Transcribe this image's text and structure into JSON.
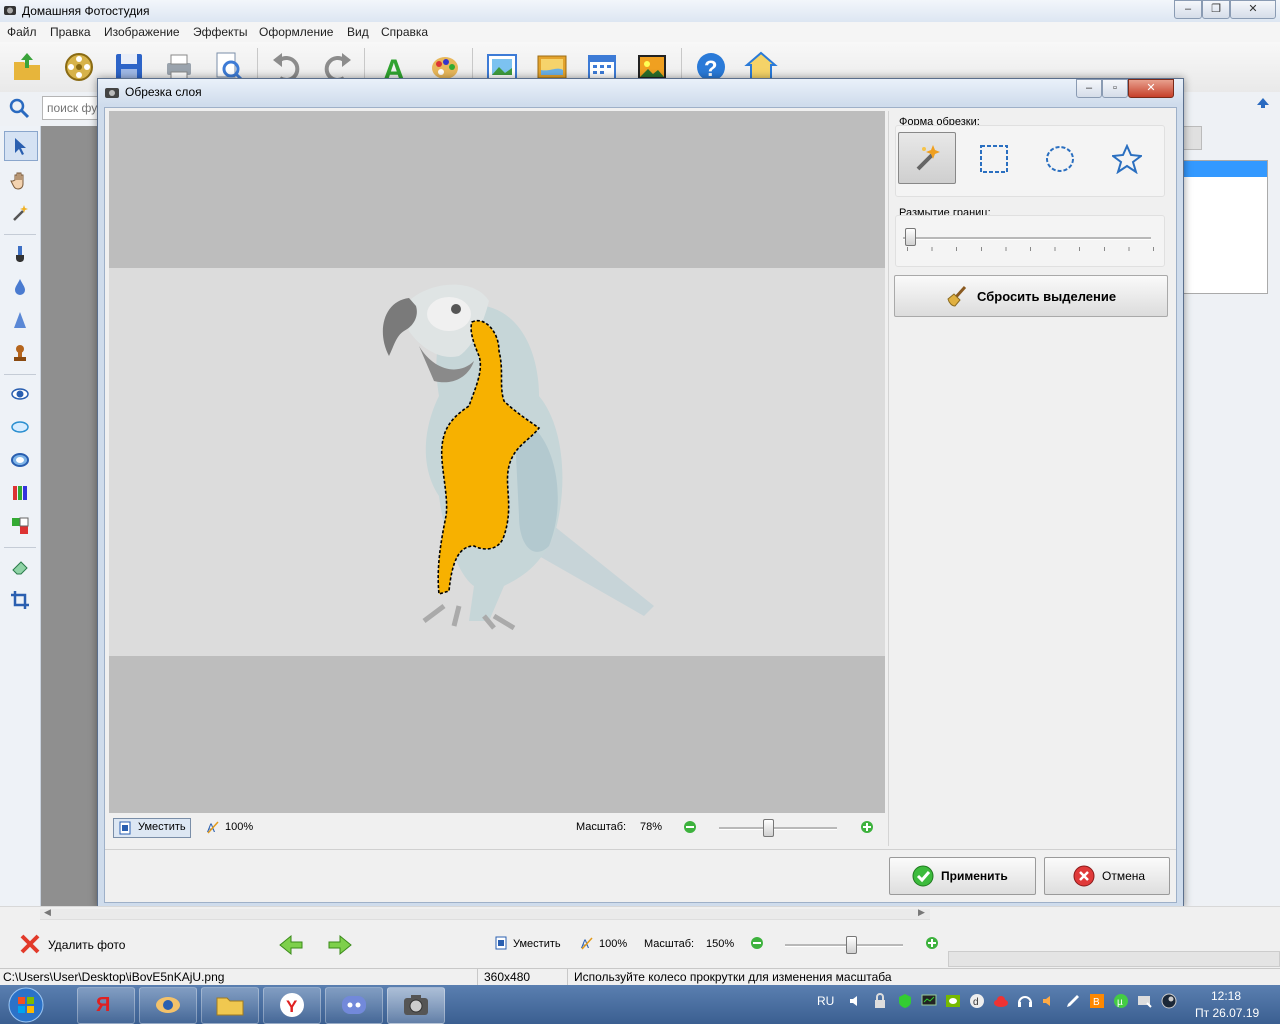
{
  "app": {
    "title": "Домашняя Фотостудия"
  },
  "menu": [
    "Файл",
    "Правка",
    "Изображение",
    "Эффекты",
    "Оформление",
    "Вид",
    "Справка"
  ],
  "search": {
    "placeholder": "поиск фу"
  },
  "dialog": {
    "title": "Обрезка слоя",
    "shape_label": "Форма обрезки:",
    "blur_label": "Размытие границ:",
    "blur_level": 0,
    "reset_label": "Сбросить выделение",
    "fit_label": "Уместить",
    "zoom100_label": "100%",
    "scale_label": "Масштаб:",
    "scale_value": "78%",
    "apply_label": "Применить",
    "cancel_label": "Отмена",
    "colors": {
      "selection": "#f7b100",
      "canvas": "#bdbdbd",
      "image_bg": "#dcdcdc"
    }
  },
  "bottom": {
    "delete_label": "Удалить фото",
    "fit_label": "Уместить",
    "zoom100_label": "100%",
    "scale_label": "Масштаб:",
    "scale_value": "150%"
  },
  "status": {
    "path": "C:\\Users\\User\\Desktop\\iBovE5nKAjU.png",
    "dimensions": "360x480",
    "hint": "Используйте колесо прокрутки для изменения масштаба"
  },
  "taskbar": {
    "lang": "RU",
    "time": "12:18",
    "date": "Пт 26.07.19"
  },
  "icons": {
    "toolbar": [
      "open-folder-icon",
      "film-reel-icon",
      "save-icon",
      "print-icon",
      "zoom-page-icon",
      "undo-icon",
      "redo-icon",
      "text-icon",
      "palette-icon",
      "frame-icon",
      "image-icon",
      "calendar-icon",
      "collage-icon",
      "help-icon",
      "home-icon"
    ],
    "left_tools": [
      "pointer-icon",
      "hand-icon",
      "magic-wand-icon",
      "brush-icon",
      "drop-icon",
      "sharpen-icon",
      "stamp-icon",
      "eye-icon",
      "redeye-icon",
      "blur-icon",
      "color-balance-icon",
      "replace-color-icon",
      "eraser-icon",
      "crop-icon"
    ],
    "shapes": [
      "magic-wand-icon",
      "rectangle-select-icon",
      "ellipse-select-icon",
      "star-select-icon"
    ]
  }
}
